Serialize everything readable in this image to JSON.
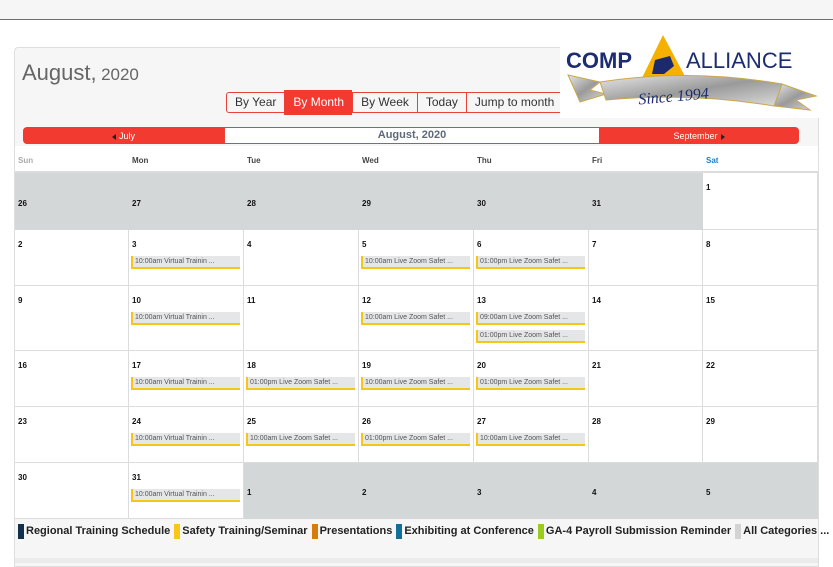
{
  "header": {
    "month": "August,",
    "year": "2020"
  },
  "view_buttons": [
    {
      "label": "By Year",
      "active": false
    },
    {
      "label": "By Month",
      "active": true
    },
    {
      "label": "By Week",
      "active": false
    },
    {
      "label": "Today",
      "active": false
    },
    {
      "label": "Jump to month",
      "active": false
    }
  ],
  "logo": {
    "left_text": "COMP",
    "right_text": "ALLIANCE",
    "ribbon_text": "Since 1994"
  },
  "month_nav": {
    "prev_label": "July",
    "current_label": "August, 2020",
    "next_label": "September"
  },
  "weekdays": [
    "Sun",
    "Mon",
    "Tue",
    "Wed",
    "Thu",
    "Fri",
    "Sat"
  ],
  "weeks": [
    [
      {
        "day": "26",
        "other": true,
        "events": []
      },
      {
        "day": "27",
        "other": true,
        "events": []
      },
      {
        "day": "28",
        "other": true,
        "events": []
      },
      {
        "day": "29",
        "other": true,
        "events": []
      },
      {
        "day": "30",
        "other": true,
        "events": []
      },
      {
        "day": "31",
        "other": true,
        "events": []
      },
      {
        "day": "1",
        "other": false,
        "events": []
      }
    ],
    [
      {
        "day": "2",
        "other": false,
        "events": []
      },
      {
        "day": "3",
        "other": false,
        "events": [
          "10:00am Virtual Trainin ..."
        ]
      },
      {
        "day": "4",
        "other": false,
        "events": []
      },
      {
        "day": "5",
        "other": false,
        "events": [
          "10:00am Live Zoom Safet ..."
        ]
      },
      {
        "day": "6",
        "other": false,
        "events": [
          "01:00pm Live Zoom Safet ..."
        ]
      },
      {
        "day": "7",
        "other": false,
        "events": []
      },
      {
        "day": "8",
        "other": false,
        "events": []
      }
    ],
    [
      {
        "day": "9",
        "other": false,
        "events": []
      },
      {
        "day": "10",
        "other": false,
        "events": [
          "10:00am Virtual Trainin ..."
        ]
      },
      {
        "day": "11",
        "other": false,
        "events": []
      },
      {
        "day": "12",
        "other": false,
        "events": [
          "10:00am Live Zoom Safet ..."
        ]
      },
      {
        "day": "13",
        "other": false,
        "events": [
          "09:00am Live Zoom Safet ...",
          "01:00pm Live Zoom Safet ..."
        ]
      },
      {
        "day": "14",
        "other": false,
        "events": []
      },
      {
        "day": "15",
        "other": false,
        "events": []
      }
    ],
    [
      {
        "day": "16",
        "other": false,
        "events": []
      },
      {
        "day": "17",
        "other": false,
        "events": [
          "10:00am Virtual Trainin ..."
        ]
      },
      {
        "day": "18",
        "other": false,
        "events": [
          "01:00pm Live Zoom Safet ..."
        ]
      },
      {
        "day": "19",
        "other": false,
        "events": [
          "10:00am Live Zoom Safet ..."
        ]
      },
      {
        "day": "20",
        "other": false,
        "events": [
          "01:00pm Live Zoom Safet ..."
        ]
      },
      {
        "day": "21",
        "other": false,
        "events": []
      },
      {
        "day": "22",
        "other": false,
        "events": []
      }
    ],
    [
      {
        "day": "23",
        "other": false,
        "events": []
      },
      {
        "day": "24",
        "other": false,
        "events": [
          "10:00am Virtual Trainin ..."
        ]
      },
      {
        "day": "25",
        "other": false,
        "events": [
          "10:00am Live Zoom Safet ..."
        ]
      },
      {
        "day": "26",
        "other": false,
        "events": [
          "01:00pm Live Zoom Safet ..."
        ]
      },
      {
        "day": "27",
        "other": false,
        "events": [
          "10:00am Live Zoom Safet ..."
        ]
      },
      {
        "day": "28",
        "other": false,
        "events": []
      },
      {
        "day": "29",
        "other": false,
        "events": []
      }
    ],
    [
      {
        "day": "30",
        "other": false,
        "events": []
      },
      {
        "day": "31",
        "other": false,
        "events": [
          "10:00am Virtual Trainin ..."
        ]
      },
      {
        "day": "1",
        "other": true,
        "events": []
      },
      {
        "day": "2",
        "other": true,
        "events": []
      },
      {
        "day": "3",
        "other": true,
        "events": []
      },
      {
        "day": "4",
        "other": true,
        "events": []
      },
      {
        "day": "5",
        "other": true,
        "events": []
      }
    ]
  ],
  "legend": [
    {
      "label": "Regional Training Schedule",
      "color": "#13314d"
    },
    {
      "label": "Safety Training/Seminar",
      "color": "#f7c81a"
    },
    {
      "label": "Presentations",
      "color": "#d97a0c"
    },
    {
      "label": "Exhibiting at Conference",
      "color": "#126f99"
    },
    {
      "label": "GA-4 Payroll Submission Reminder",
      "color": "#9ccb1f"
    },
    {
      "label": "All Categories ...",
      "color": "#d3d3d3"
    }
  ],
  "colors": {
    "accent": "#f23a30",
    "event_border": "#f5c518",
    "saturday": "#1e7ec8",
    "other_month_bg": "#d4d7d8"
  }
}
